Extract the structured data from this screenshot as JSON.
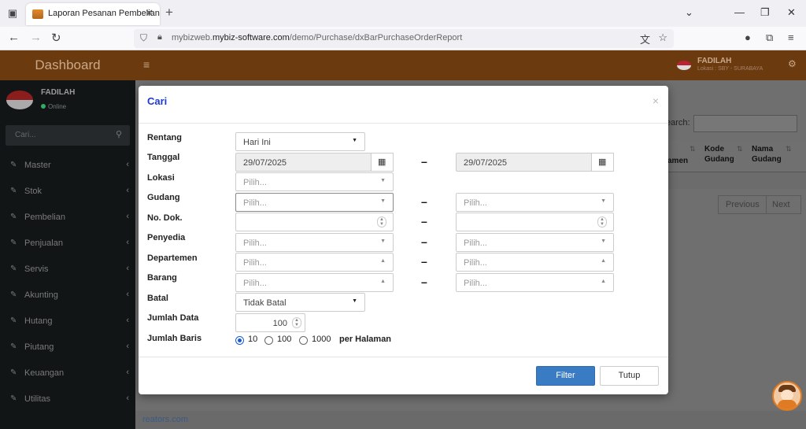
{
  "browser": {
    "tab_title": "Laporan Pesanan Pembelian",
    "url_prefix": "mybizweb.",
    "url_domain": "mybiz-software.com",
    "url_path": "/demo/Purchase/dxBarPurchaseOrderReport"
  },
  "app": {
    "logo": "Dashboard",
    "user_name": "FADILAH",
    "user_location": "Lokasi : SBY - SURABAYA",
    "sidebar_user_name": "FADILAH",
    "sidebar_status": "Online",
    "sidebar_search_placeholder": "Cari...",
    "sidebar_items": [
      {
        "label": "Master"
      },
      {
        "label": "Stok"
      },
      {
        "label": "Pembelian"
      },
      {
        "label": "Penjualan"
      },
      {
        "label": "Servis"
      },
      {
        "label": "Akunting"
      },
      {
        "label": "Hutang"
      },
      {
        "label": "Piutang"
      },
      {
        "label": "Keuangan"
      },
      {
        "label": "Utilitas"
      }
    ],
    "bg_search_label": "earch:",
    "bg_col_1": "amen",
    "bg_col_2a": "Kode",
    "bg_col_2b": "Gudang",
    "bg_col_3a": "Nama",
    "bg_col_3b": "Gudang",
    "bg_prev": "Previous",
    "bg_next": "Next",
    "footer_text": "reators.com"
  },
  "modal": {
    "title": "Cari",
    "close": "×",
    "labels": {
      "rentang": "Rentang",
      "tanggal": "Tanggal",
      "lokasi": "Lokasi",
      "gudang": "Gudang",
      "no_dok": "No. Dok.",
      "penyedia": "Penyedia",
      "departemen": "Departemen",
      "barang": "Barang",
      "batal": "Batal",
      "jumlah_data": "Jumlah Data",
      "jumlah_baris": "Jumlah Baris"
    },
    "rentang_value": "Hari Ini",
    "tanggal_from": "29/07/2025",
    "tanggal_to": "29/07/2025",
    "placeholder": "Pilih...",
    "batal_value": "Tidak Batal",
    "jumlah_data_value": "100",
    "rows_options": [
      "10",
      "100",
      "1000"
    ],
    "rows_selected": "10",
    "rows_suffix": "per Halaman",
    "dash": "–",
    "filter_button": "Filter",
    "close_button": "Tutup"
  }
}
